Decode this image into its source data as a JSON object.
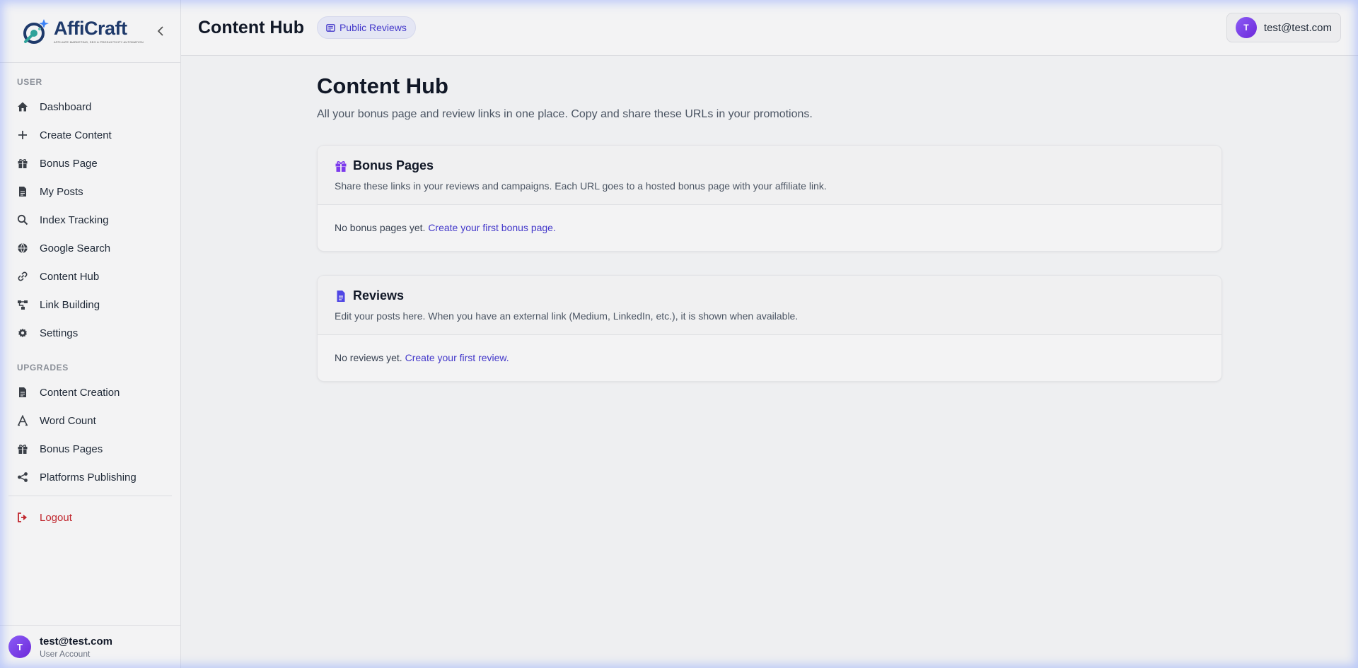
{
  "brand": {
    "name": "AffiCraft",
    "tagline": "AFFILIATE MARKETING, SEO & PRODUCTIVITY AUTOMATION"
  },
  "sidebar": {
    "user_section_label": "USER",
    "user_items": [
      {
        "label": "Dashboard",
        "icon": "home-icon"
      },
      {
        "label": "Create Content",
        "icon": "plus-icon"
      },
      {
        "label": "Bonus Page",
        "icon": "gift-icon"
      },
      {
        "label": "My Posts",
        "icon": "file-icon"
      },
      {
        "label": "Index Tracking",
        "icon": "search-icon"
      },
      {
        "label": "Google Search",
        "icon": "globe-icon"
      },
      {
        "label": "Content Hub",
        "icon": "link-icon"
      },
      {
        "label": "Link Building",
        "icon": "sitemap-icon"
      },
      {
        "label": "Settings",
        "icon": "gear-icon"
      }
    ],
    "upgrades_section_label": "UPGRADES",
    "upgrade_items": [
      {
        "label": "Content Creation",
        "icon": "file-icon"
      },
      {
        "label": "Word Count",
        "icon": "font-icon"
      },
      {
        "label": "Bonus Pages",
        "icon": "gift-icon"
      },
      {
        "label": "Platforms Publishing",
        "icon": "share-icon"
      }
    ],
    "logout_label": "Logout",
    "user": {
      "initial": "T",
      "email": "test@test.com",
      "role": "User Account"
    }
  },
  "header": {
    "title": "Content Hub",
    "pill_label": "Public Reviews",
    "user_initial": "T",
    "user_email": "test@test.com"
  },
  "main": {
    "title": "Content Hub",
    "subtitle": "All your bonus page and review links in one place. Copy and share these URLs in your promotions.",
    "bonus_card": {
      "title": "Bonus Pages",
      "description": "Share these links in your reviews and campaigns. Each URL goes to a hosted bonus page with your affiliate link.",
      "empty_text": "No bonus pages yet.",
      "empty_link": "Create your first bonus page."
    },
    "reviews_card": {
      "title": "Reviews",
      "description": "Edit your posts here. When you have an external link (Medium, LinkedIn, etc.), it is shown when available.",
      "empty_text": "No reviews yet.",
      "empty_link": "Create your first review."
    }
  },
  "colors": {
    "accent": "#4338ca",
    "avatar": "#7c3aed",
    "logout": "#c0262d"
  }
}
